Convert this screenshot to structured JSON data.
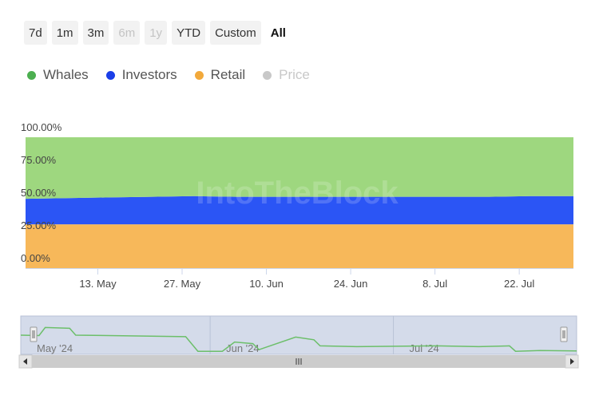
{
  "range_selector": {
    "buttons": [
      {
        "label": "7d",
        "state": "normal"
      },
      {
        "label": "1m",
        "state": "normal"
      },
      {
        "label": "3m",
        "state": "normal"
      },
      {
        "label": "6m",
        "state": "disabled"
      },
      {
        "label": "1y",
        "state": "disabled"
      },
      {
        "label": "YTD",
        "state": "normal"
      },
      {
        "label": "Custom",
        "state": "normal"
      },
      {
        "label": "All",
        "state": "active"
      }
    ]
  },
  "legend": {
    "items": [
      {
        "label": "Whales",
        "color": "#4caf50",
        "visible": true
      },
      {
        "label": "Investors",
        "color": "#1a3ee8",
        "visible": true
      },
      {
        "label": "Retail",
        "color": "#f2a93b",
        "visible": true
      },
      {
        "label": "Price",
        "color": "#c8c8c8",
        "visible": false
      }
    ]
  },
  "watermark": "IntoTheBlock",
  "chart_data": {
    "type": "area",
    "stacking": "percent",
    "x": [
      "2024-05-01",
      "2024-05-08",
      "2024-05-15",
      "2024-05-22",
      "2024-05-29",
      "2024-06-05",
      "2024-06-12",
      "2024-06-19",
      "2024-06-26",
      "2024-07-03",
      "2024-07-10",
      "2024-07-17",
      "2024-07-24",
      "2024-07-31"
    ],
    "series": [
      {
        "name": "Retail",
        "color": "#f7b85a",
        "values": [
          33.5,
          33.5,
          33.5,
          33.5,
          33.5,
          33.5,
          33.5,
          33.5,
          33.5,
          33.5,
          33.5,
          33.5,
          33.5,
          33.5
        ]
      },
      {
        "name": "Investors",
        "color": "#2b55f5",
        "values": [
          19.5,
          20.0,
          20.5,
          21.0,
          21.5,
          21.0,
          21.0,
          21.0,
          21.0,
          21.0,
          21.0,
          21.0,
          21.5,
          21.5
        ]
      },
      {
        "name": "Whales",
        "color": "#9ed77f",
        "values": [
          47.0,
          46.5,
          46.0,
          45.5,
          45.0,
          45.5,
          45.5,
          45.5,
          45.5,
          45.5,
          45.5,
          45.5,
          45.0,
          45.0
        ]
      }
    ],
    "yaxis": {
      "ticks": [
        "0.00%",
        "25.00%",
        "50.00%",
        "75.00%",
        "100.00%"
      ],
      "ylim": [
        0,
        100
      ]
    },
    "xaxis": {
      "ticks": [
        {
          "label": "13. May",
          "date": "2024-05-13"
        },
        {
          "label": "27. May",
          "date": "2024-05-27"
        },
        {
          "label": "10. Jun",
          "date": "2024-06-10"
        },
        {
          "label": "24. Jun",
          "date": "2024-06-24"
        },
        {
          "label": "8. Jul",
          "date": "2024-07-08"
        },
        {
          "label": "22. Jul",
          "date": "2024-07-22"
        }
      ]
    },
    "grid": false,
    "navigator": {
      "labels": [
        {
          "label": "May '24",
          "date": "2024-05-01"
        },
        {
          "label": "Jun '24",
          "date": "2024-06-01"
        },
        {
          "label": "Jul '24",
          "date": "2024-07-01"
        }
      ],
      "line_color": "#6cbf6a",
      "series": [
        [
          "2024-05-01",
          50
        ],
        [
          "2024-05-04",
          49
        ],
        [
          "2024-05-05",
          70
        ],
        [
          "2024-05-09",
          68
        ],
        [
          "2024-05-10",
          50
        ],
        [
          "2024-05-20",
          48
        ],
        [
          "2024-05-28",
          46
        ],
        [
          "2024-05-30",
          8
        ],
        [
          "2024-06-03",
          8
        ],
        [
          "2024-06-05",
          32
        ],
        [
          "2024-06-08",
          28
        ],
        [
          "2024-06-09",
          12
        ],
        [
          "2024-06-15",
          45
        ],
        [
          "2024-06-18",
          38
        ],
        [
          "2024-06-19",
          22
        ],
        [
          "2024-06-25",
          20
        ],
        [
          "2024-07-08",
          22
        ],
        [
          "2024-07-15",
          20
        ],
        [
          "2024-07-20",
          22
        ],
        [
          "2024-07-21",
          8
        ],
        [
          "2024-07-25",
          10
        ],
        [
          "2024-07-31",
          9
        ]
      ]
    }
  }
}
